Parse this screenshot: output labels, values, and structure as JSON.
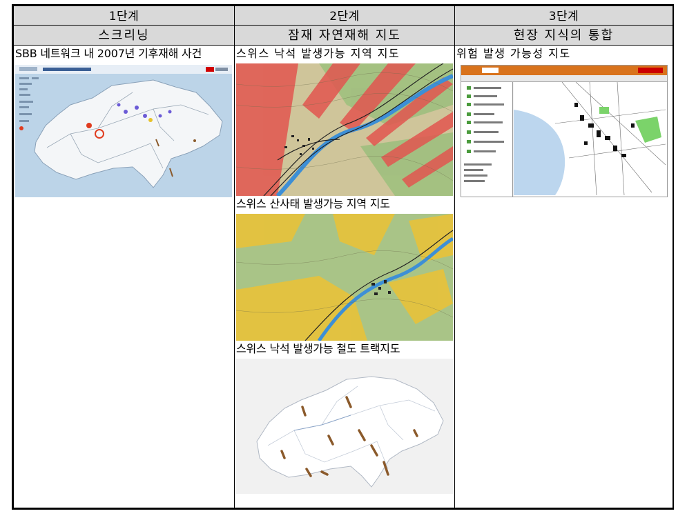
{
  "table": {
    "stages": [
      "1단계",
      "2단계",
      "3단계"
    ],
    "titles": [
      "스크리닝",
      "잠재 자연재해 지도",
      "현장 지식의 통합"
    ]
  },
  "col1": {
    "caption": "SBB 네트워크 내 2007년 기후재해 사건"
  },
  "col2": {
    "captions": [
      "스위스 낙석 발생가능 지역 지도",
      "스위스 산사태 발생가능 지역 지도",
      "스위스 낙석 발생가능 철도 트랙지도"
    ]
  },
  "col3": {
    "caption": "위험 발생 가능성 지도"
  },
  "colors": {
    "header_bg": "#d9d9d9",
    "rockfall_red": "#d9534f",
    "landslide_yellow": "#e8c23a",
    "track_brown": "#8b5a2b",
    "app_orange": "#d9731c",
    "lake_blue": "#bcd6ee"
  }
}
